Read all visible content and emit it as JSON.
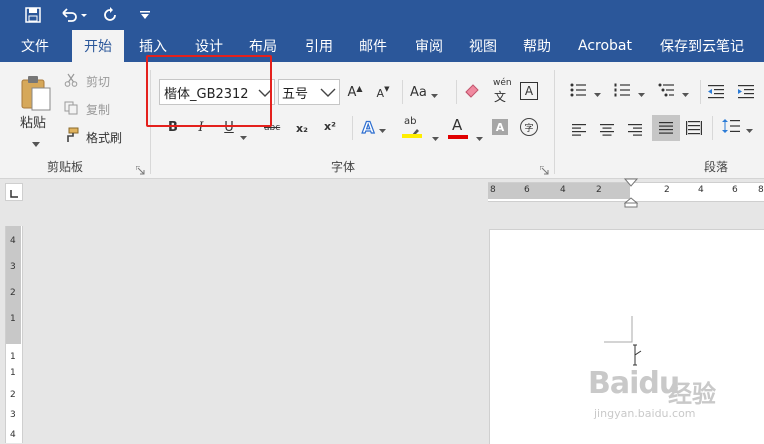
{
  "tabs": [
    "文件",
    "开始",
    "插入",
    "设计",
    "布局",
    "引用",
    "邮件",
    "审阅",
    "视图",
    "帮助",
    "Acrobat",
    "保存到云笔记"
  ],
  "active_tab": "开始",
  "clipboard": {
    "paste": "粘贴",
    "cut": "剪切",
    "copy": "复制",
    "format_painter": "格式刷",
    "group_label": "剪贴板"
  },
  "font": {
    "font_name": "楷体_GB2312",
    "font_size": "五号",
    "group_label": "字体",
    "case_label": "Aa",
    "phonetic_top": "wén",
    "phonetic_bottom": "文",
    "bold": "B",
    "italic": "I",
    "underline": "U",
    "strike": "abc",
    "subscript": "x₂",
    "superscript": "x²",
    "grow": "A",
    "shrink": "A",
    "text_effect": "A",
    "highlight": "ab",
    "font_color": "A",
    "char_shading": "A",
    "enclosed": "字",
    "char_border": "A"
  },
  "paragraph": {
    "group_label": "段落"
  },
  "ruler_h_labels": [
    "8",
    "6",
    "4",
    "2",
    "2",
    "4",
    "6",
    "8"
  ],
  "ruler_v_labels": [
    "4",
    "3",
    "2",
    "1",
    "1",
    "1",
    "2",
    "3",
    "4"
  ],
  "watermark": {
    "brand": "Baidu",
    "cn": "经验",
    "url": "jingyan.baidu.com"
  },
  "colors": {
    "title_blue": "#2b579a",
    "highlight_box": "#e4201c",
    "font_color_bar": "#e00000",
    "highlight_bar": "#ffee00"
  }
}
